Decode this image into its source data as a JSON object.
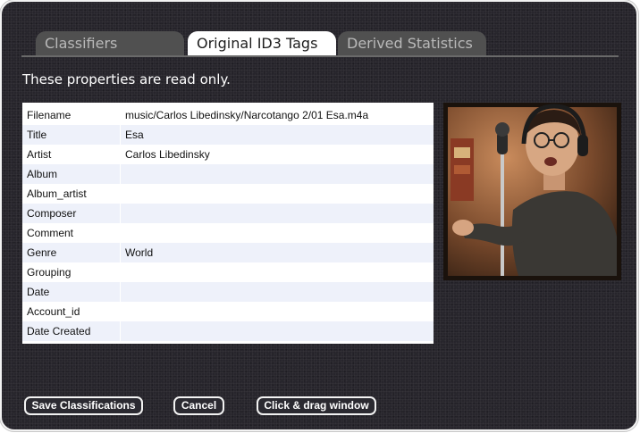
{
  "tabs": [
    {
      "label": "Classifiers",
      "active": false
    },
    {
      "label": "Original ID3 Tags",
      "active": true
    },
    {
      "label": "Derived Statistics",
      "active": false
    }
  ],
  "readonly_note": "These properties are read only.",
  "properties": [
    {
      "key": "Filename",
      "value": "music/Carlos Libedinsky/Narcotango 2/01 Esa.m4a"
    },
    {
      "key": "Title",
      "value": "Esa"
    },
    {
      "key": "Artist",
      "value": "Carlos Libedinsky"
    },
    {
      "key": "Album",
      "value": ""
    },
    {
      "key": "Album_artist",
      "value": ""
    },
    {
      "key": "Composer",
      "value": ""
    },
    {
      "key": "Comment",
      "value": ""
    },
    {
      "key": "Genre",
      "value": "World"
    },
    {
      "key": "Grouping",
      "value": ""
    },
    {
      "key": "Date",
      "value": ""
    },
    {
      "key": "Account_id",
      "value": ""
    },
    {
      "key": "Date Created",
      "value": ""
    }
  ],
  "buttons": {
    "save": "Save Classifications",
    "cancel": "Cancel",
    "drag": "Click & drag window"
  },
  "colors": {
    "panel_bg": "#27252c",
    "tab_inactive": "#505050",
    "tab_active": "#ffffff",
    "row_alt": "#eef1fa"
  },
  "photo": {
    "icon": "artist-photo"
  }
}
